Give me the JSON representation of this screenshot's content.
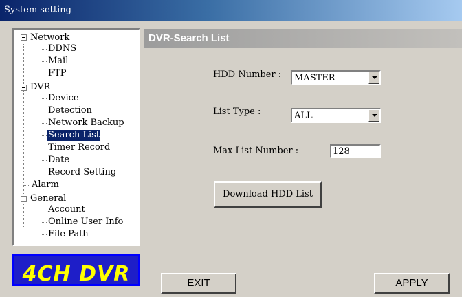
{
  "window": {
    "title": "System setting"
  },
  "tree": {
    "network": "Network",
    "ddns": "DDNS",
    "mail": "Mail",
    "ftp": "FTP",
    "dvr": "DVR",
    "device": "Device",
    "detection": "Detection",
    "network_backup": "Network Backup",
    "search_list": "Search List",
    "timer_record": "Timer Record",
    "date": "Date",
    "record_setting": "Record Setting",
    "alarm": "Alarm",
    "general": "General",
    "account": "Account",
    "online_user_info": "Online User Info",
    "file_path": "File Path",
    "selected": "Search List"
  },
  "logo": {
    "text": "4CH DVR"
  },
  "panel": {
    "title": "DVR-Search List",
    "hdd_number_label": "HDD Number :",
    "hdd_number_value": "MASTER",
    "list_type_label": "List Type :",
    "list_type_value": "ALL",
    "max_list_label": "Max List Number :",
    "max_list_value": "128",
    "download_button": "Download HDD List"
  },
  "footer": {
    "exit_button": "EXIT",
    "apply_button": "APPLY"
  }
}
